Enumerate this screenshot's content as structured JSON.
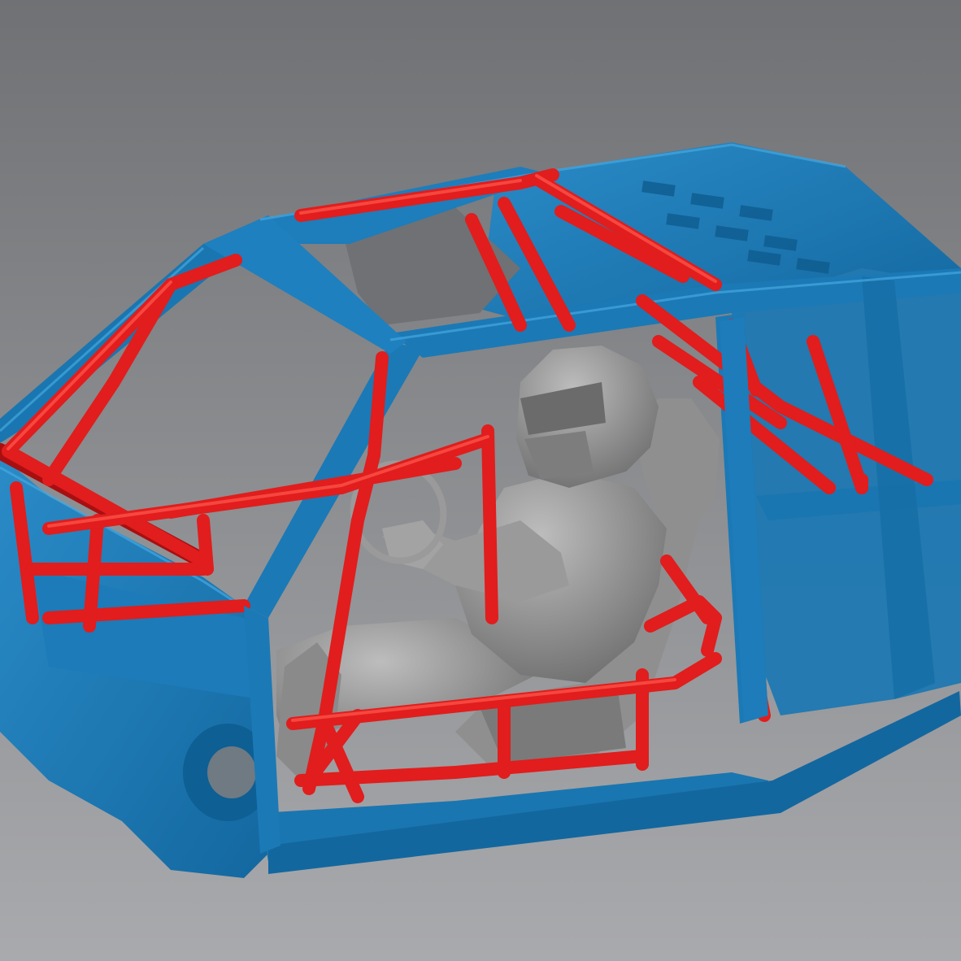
{
  "scene": {
    "subjects": [
      "car-body-scan",
      "roll-cage",
      "driver",
      "racing-seat",
      "steering-wheel"
    ],
    "colors": {
      "background_top": "#6f7174",
      "background_bottom": "#a9aaad",
      "body": "#1b7ab5",
      "body_dark": "#0d5f94",
      "body_light": "#3fa0d8",
      "cage": "#e11d1d",
      "cage_dark": "#a80f10",
      "driver": "#8a8a8a",
      "driver_dark": "#5f5f5f",
      "driver_light": "#b9b9b9"
    }
  }
}
